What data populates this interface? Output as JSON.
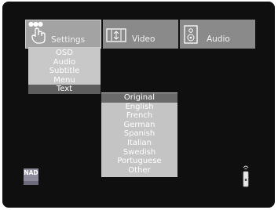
{
  "tabs": [
    {
      "label": "Settings",
      "icon": "hand-pointer-icon",
      "active": true
    },
    {
      "label": "Video",
      "icon": "video-screen-icon",
      "active": false
    },
    {
      "label": "Audio",
      "icon": "speaker-icon",
      "active": false
    }
  ],
  "settings_menu": [
    "OSD",
    "Audio",
    "Subtitle",
    "Menu",
    "Text"
  ],
  "settings_selected": "Text",
  "text_options": [
    "Original",
    "English",
    "French",
    "German",
    "Spanish",
    "Italian",
    "Swedish",
    "Portuguese",
    "Other"
  ],
  "text_selected": "Original",
  "logo_text": "NAD",
  "remote_icon": "remote-control-icon"
}
